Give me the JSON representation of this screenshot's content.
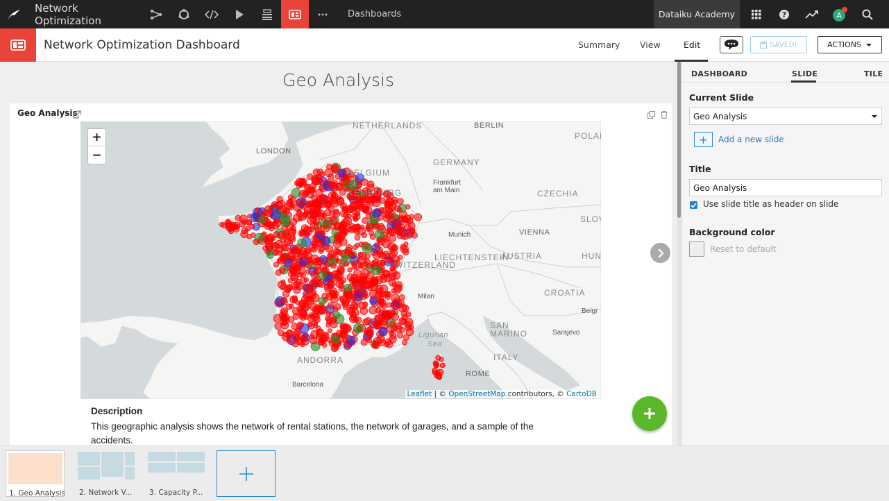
{
  "topbar": {
    "project_name": "Network Optimization",
    "section_label": "Dashboards",
    "academy_label": "Dataiku Academy",
    "avatar_letter": "A",
    "colors": {
      "bar": "#222222",
      "accent": "#e9433a",
      "avatar": "#2aa876"
    }
  },
  "header": {
    "dashboard_title": "Network Optimization Dashboard",
    "nav": {
      "summary": "Summary",
      "view": "View",
      "edit": "Edit"
    },
    "saved_label": "SAVED!",
    "actions_label": "ACTIONS"
  },
  "slide": {
    "title": "Geo Analysis",
    "tile": {
      "title": "Geo Analysis",
      "description_title": "Description",
      "description_text": "This geographic analysis shows the network of rental stations, the network of garages, and a sample of the accidents."
    }
  },
  "map": {
    "zoom_in": "+",
    "zoom_out": "−",
    "attribution": {
      "leaflet": "Leaflet",
      "sep1": " | © ",
      "osm": "OpenStreetMap",
      "mid": " contributors, © ",
      "carto": "CartoDB"
    },
    "labels": [
      {
        "text": "NETHERLANDS",
        "kind": "country"
      },
      {
        "text": "BERLIN",
        "kind": "city"
      },
      {
        "text": "POLAN",
        "kind": "country"
      },
      {
        "text": "LONDON",
        "kind": "city"
      },
      {
        "text": "BELGIUM",
        "kind": "country"
      },
      {
        "text": "GERMANY",
        "kind": "country"
      },
      {
        "text": "Frankfurt",
        "kind": "town"
      },
      {
        "text": "am Main",
        "kind": "town"
      },
      {
        "text": "XEMBOURG",
        "kind": "country"
      },
      {
        "text": "CZECHIA",
        "kind": "country"
      },
      {
        "text": "SLOV",
        "kind": "country"
      },
      {
        "text": "Munich",
        "kind": "town"
      },
      {
        "text": "VIENNA",
        "kind": "city"
      },
      {
        "text": "LIECHTENSTEIN",
        "kind": "country"
      },
      {
        "text": "AUSTRIA",
        "kind": "country"
      },
      {
        "text": "HUNG",
        "kind": "country"
      },
      {
        "text": "WITZERLAND",
        "kind": "country"
      },
      {
        "text": "Milan",
        "kind": "town"
      },
      {
        "text": "CROATIA",
        "kind": "country"
      },
      {
        "text": "Belgr",
        "kind": "town"
      },
      {
        "text": "SAN",
        "kind": "country"
      },
      {
        "text": "MARINO",
        "kind": "country"
      },
      {
        "text": "Sarajevo",
        "kind": "town"
      },
      {
        "text": "Ligurian",
        "kind": "sea"
      },
      {
        "text": "Sea",
        "kind": "sea"
      },
      {
        "text": "ANDORRA",
        "kind": "country"
      },
      {
        "text": "ITALY",
        "kind": "country"
      },
      {
        "text": "ROME",
        "kind": "city"
      },
      {
        "text": "Barcelona",
        "kind": "town"
      }
    ],
    "point_colors": {
      "accidents": "#ff0000",
      "stations": "#2233dd",
      "garages": "#2a8a2a"
    }
  },
  "panel": {
    "tabs": {
      "dashboard": "DASHBOARD",
      "slide": "SLIDE",
      "tile": "TILE"
    },
    "current_slide_label": "Current Slide",
    "current_slide_value": "Geo Analysis",
    "add_slide_label": "Add a new slide",
    "title_label": "Title",
    "title_value": "Geo Analysis",
    "use_title_label": "Use slide title as header on slide",
    "use_title_checked": true,
    "bg_label": "Background color",
    "reset_label": "Reset to default"
  },
  "thumbnails": [
    {
      "label": "1. Geo Analysis"
    },
    {
      "label": "2. Network V..."
    },
    {
      "label": "3. Capacity P..."
    }
  ]
}
